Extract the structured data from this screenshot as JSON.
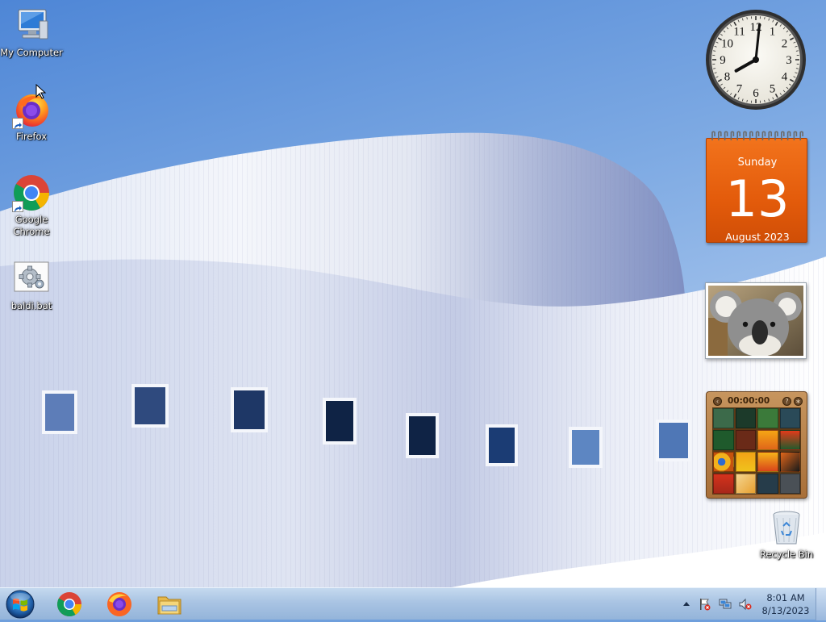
{
  "desktop": {
    "icons": [
      {
        "label": "My Computer",
        "icon": "computer-icon"
      },
      {
        "label": "Firefox",
        "icon": "firefox-icon"
      },
      {
        "label": "Google Chrome",
        "icon": "chrome-icon"
      },
      {
        "label": "baldi.bat",
        "icon": "batch-file-gear-icon"
      },
      {
        "label": "Recycle Bin",
        "icon": "recycle-bin-icon"
      }
    ]
  },
  "gadgets": {
    "clock": {
      "numerals": [
        "12",
        "1",
        "2",
        "3",
        "4",
        "5",
        "6",
        "7",
        "8",
        "9",
        "10",
        "11"
      ],
      "hour": 8,
      "minute": 1
    },
    "calendar": {
      "weekday": "Sunday",
      "day": "13",
      "month_year": "August 2023",
      "color": "#e8600f"
    },
    "slideshow": {
      "image": "koala-photo"
    },
    "puzzle": {
      "timer": "00:00:00"
    }
  },
  "taskbar": {
    "start_icon": "windows-start-orb-icon",
    "pinned": [
      "chrome-icon",
      "firefox-icon",
      "file-explorer-icon"
    ],
    "tray_icons": [
      "show-hidden-icons-arrow",
      "action-center-flag-icon",
      "network-icon",
      "volume-muted-icon"
    ],
    "clock": {
      "time": "8:01 AM",
      "date": "8/13/2023"
    }
  },
  "colors": {
    "sky": "#6f9fdc",
    "taskbar": "#a9c4e3",
    "calendar_orange": "#e8600f"
  }
}
